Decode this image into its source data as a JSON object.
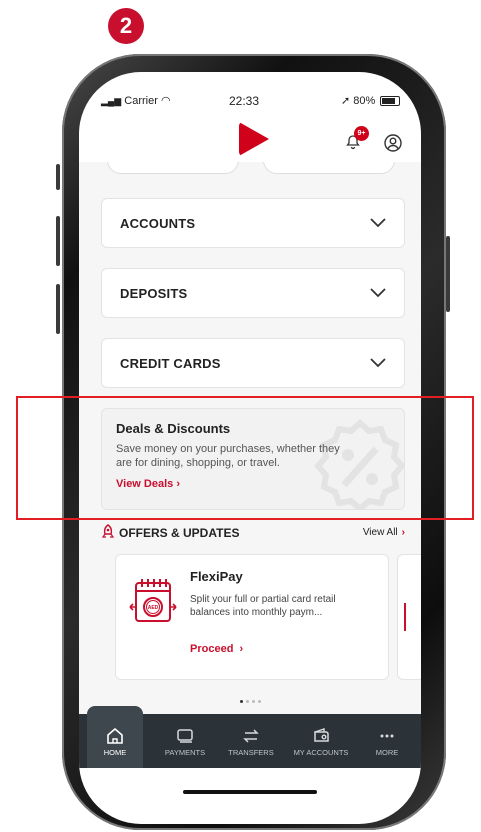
{
  "step_badge": "2",
  "status_bar": {
    "carrier": "Carrier",
    "time": "22:33",
    "battery": "80%"
  },
  "header": {
    "notification_count": "9+"
  },
  "accordions": [
    {
      "label": "ACCOUNTS"
    },
    {
      "label": "DEPOSITS"
    },
    {
      "label": "CREDIT CARDS"
    }
  ],
  "deals": {
    "title": "Deals & Discounts",
    "description": "Save money on your purchases, whether they are for dining, shopping, or travel.",
    "link": "View Deals"
  },
  "offers": {
    "title": "OFFERS & UPDATES",
    "view_all": "View All",
    "card": {
      "title": "FlexiPay",
      "description": "Split your full or partial card retail balances into monthly paym...",
      "action": "Proceed",
      "icon_text": "AED"
    }
  },
  "tabs": [
    {
      "label": "HOME",
      "icon": "home-icon"
    },
    {
      "label": "PAYMENTS",
      "icon": "payments-icon"
    },
    {
      "label": "TRANSFERS",
      "icon": "transfers-icon"
    },
    {
      "label": "MY ACCOUNTS",
      "icon": "wallet-icon"
    },
    {
      "label": "MORE",
      "icon": "more-icon"
    }
  ],
  "colors": {
    "accent": "#c8102e",
    "tabbar": "#2b3338",
    "highlight_box": "#e21d24"
  }
}
